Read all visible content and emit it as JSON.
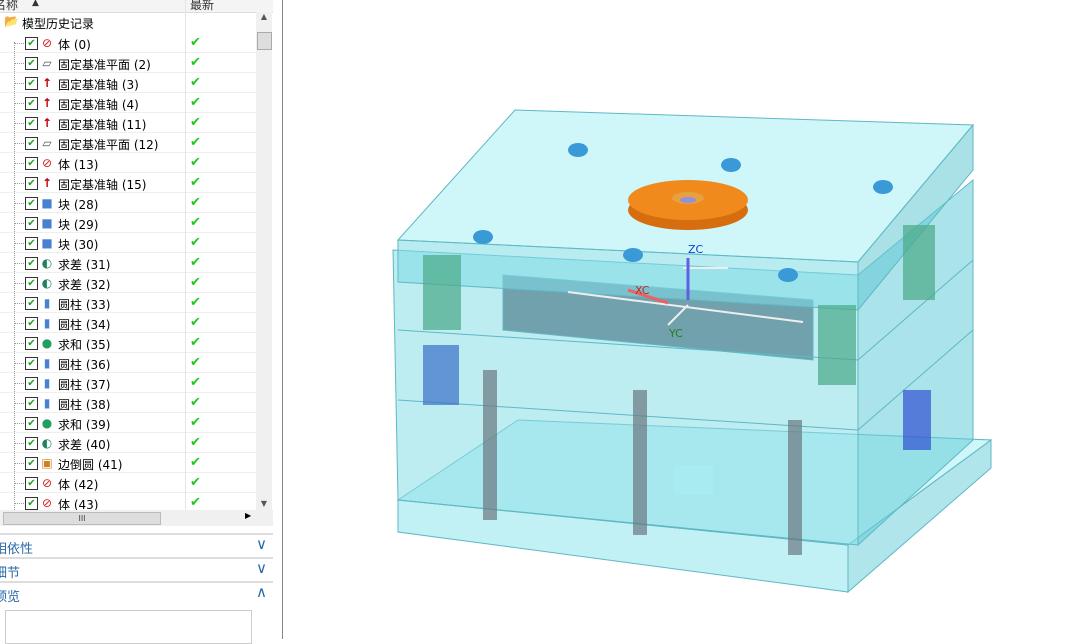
{
  "header": {
    "col_name": "名称",
    "col_latest": "最新"
  },
  "root": "模型历史记录",
  "rows": [
    {
      "icon": "body",
      "label": "体 (0)"
    },
    {
      "icon": "datum-plane",
      "label": "固定基准平面 (2)"
    },
    {
      "icon": "datum-axis",
      "label": "固定基准轴 (3)"
    },
    {
      "icon": "datum-axis",
      "label": "固定基准轴 (4)"
    },
    {
      "icon": "datum-axis",
      "label": "固定基准轴 (11)"
    },
    {
      "icon": "datum-plane",
      "label": "固定基准平面 (12)"
    },
    {
      "icon": "body",
      "label": "体 (13)"
    },
    {
      "icon": "datum-axis",
      "label": "固定基准轴 (15)"
    },
    {
      "icon": "block",
      "label": "块 (28)"
    },
    {
      "icon": "block",
      "label": "块 (29)"
    },
    {
      "icon": "block",
      "label": "块 (30)"
    },
    {
      "icon": "subtract",
      "label": "求差 (31)"
    },
    {
      "icon": "subtract",
      "label": "求差 (32)"
    },
    {
      "icon": "cylinder",
      "label": "圆柱 (33)"
    },
    {
      "icon": "cylinder",
      "label": "圆柱 (34)"
    },
    {
      "icon": "unite",
      "label": "求和 (35)"
    },
    {
      "icon": "cylinder",
      "label": "圆柱 (36)"
    },
    {
      "icon": "cylinder",
      "label": "圆柱 (37)"
    },
    {
      "icon": "cylinder",
      "label": "圆柱 (38)"
    },
    {
      "icon": "unite",
      "label": "求和 (39)"
    },
    {
      "icon": "subtract",
      "label": "求差 (40)"
    },
    {
      "icon": "edge-blend",
      "label": "边倒圆 (41)"
    },
    {
      "icon": "body",
      "label": "体 (42)"
    },
    {
      "icon": "body",
      "label": "体 (43)"
    }
  ],
  "scroll_grip": "III",
  "sections": [
    {
      "label": "相依性",
      "state": "collapsed",
      "chevron": "∨"
    },
    {
      "label": "细节",
      "state": "collapsed",
      "chevron": "∨"
    },
    {
      "label": "预览",
      "state": "expanded",
      "chevron": "∧"
    }
  ],
  "viewport": {
    "axes": {
      "z": "ZC",
      "x": "XC",
      "y": "YC"
    },
    "colors": {
      "plate": "#7fe0e8",
      "locating_ring": "#f08a1c",
      "accent": "#2a6aa8"
    }
  }
}
